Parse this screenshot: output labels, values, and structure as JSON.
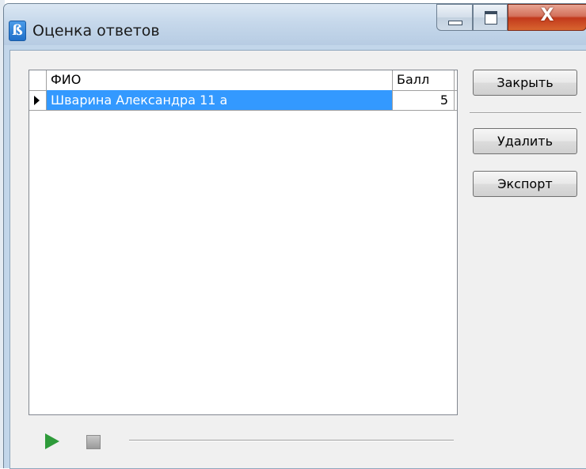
{
  "window": {
    "title": "Оценка ответов",
    "app_icon_glyph": "ß",
    "close_glyph": "X"
  },
  "grid": {
    "columns": [
      "ФИО",
      "Балл"
    ],
    "rows": [
      {
        "name": "Шварина Александра 11 а",
        "score": "5",
        "selected": true
      }
    ]
  },
  "buttons": {
    "close": "Закрыть",
    "delete": "Удалить",
    "export": "Экспорт"
  },
  "player": {
    "play_icon": "play-icon",
    "stop_icon": "stop-icon",
    "progress": 0
  },
  "colors": {
    "selection": "#3399ff",
    "play": "#2e9b3a",
    "close_button": "#c2391c"
  }
}
